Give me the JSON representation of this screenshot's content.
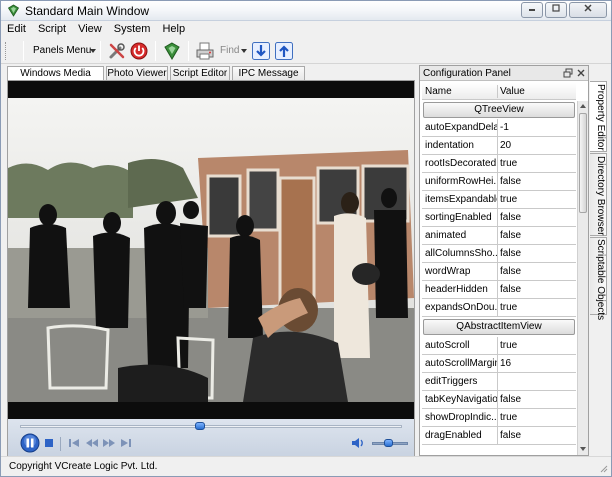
{
  "window": {
    "title": "Standard Main Window"
  },
  "menu": {
    "items": [
      "Edit",
      "Script",
      "View",
      "System",
      "Help"
    ]
  },
  "toolbar": {
    "panels_menu": "Panels Menu",
    "find_label": "Find"
  },
  "tabs": [
    {
      "label": "Windows Media Player",
      "active": true
    },
    {
      "label": "Photo Viewer",
      "active": false
    },
    {
      "label": "Script Editor",
      "active": false
    },
    {
      "label": "IPC Message Log",
      "active": false
    }
  ],
  "player": {
    "seek_position": 0.47,
    "volume_level": 0.45
  },
  "config_panel": {
    "title": "Configuration Panel",
    "col_name": "Name",
    "col_value": "Value",
    "groups": [
      {
        "title": "QTreeView",
        "rows": [
          {
            "name": "autoExpandDelay",
            "value": "-1"
          },
          {
            "name": "indentation",
            "value": "20"
          },
          {
            "name": "rootIsDecorated",
            "value": "true"
          },
          {
            "name": "uniformRowHei...",
            "value": "false"
          },
          {
            "name": "itemsExpandable",
            "value": "true"
          },
          {
            "name": "sortingEnabled",
            "value": "false"
          },
          {
            "name": "animated",
            "value": "false"
          },
          {
            "name": "allColumnsSho...",
            "value": "false"
          },
          {
            "name": "wordWrap",
            "value": "false"
          },
          {
            "name": "headerHidden",
            "value": "false"
          },
          {
            "name": "expandsOnDou...",
            "value": "true"
          }
        ]
      },
      {
        "title": "QAbstractItemView",
        "rows": [
          {
            "name": "autoScroll",
            "value": "true"
          },
          {
            "name": "autoScrollMargin",
            "value": "16"
          },
          {
            "name": "editTriggers",
            "value": ""
          },
          {
            "name": "tabKeyNavigation",
            "value": "false"
          },
          {
            "name": "showDropIndic...",
            "value": "true"
          },
          {
            "name": "dragEnabled",
            "value": "false"
          }
        ]
      }
    ]
  },
  "side_tabs": [
    "Property Editor",
    "Directory Browser",
    "Scriptable Objects"
  ],
  "status": {
    "text": "Copyright VCreate Logic Pvt. Ltd."
  }
}
